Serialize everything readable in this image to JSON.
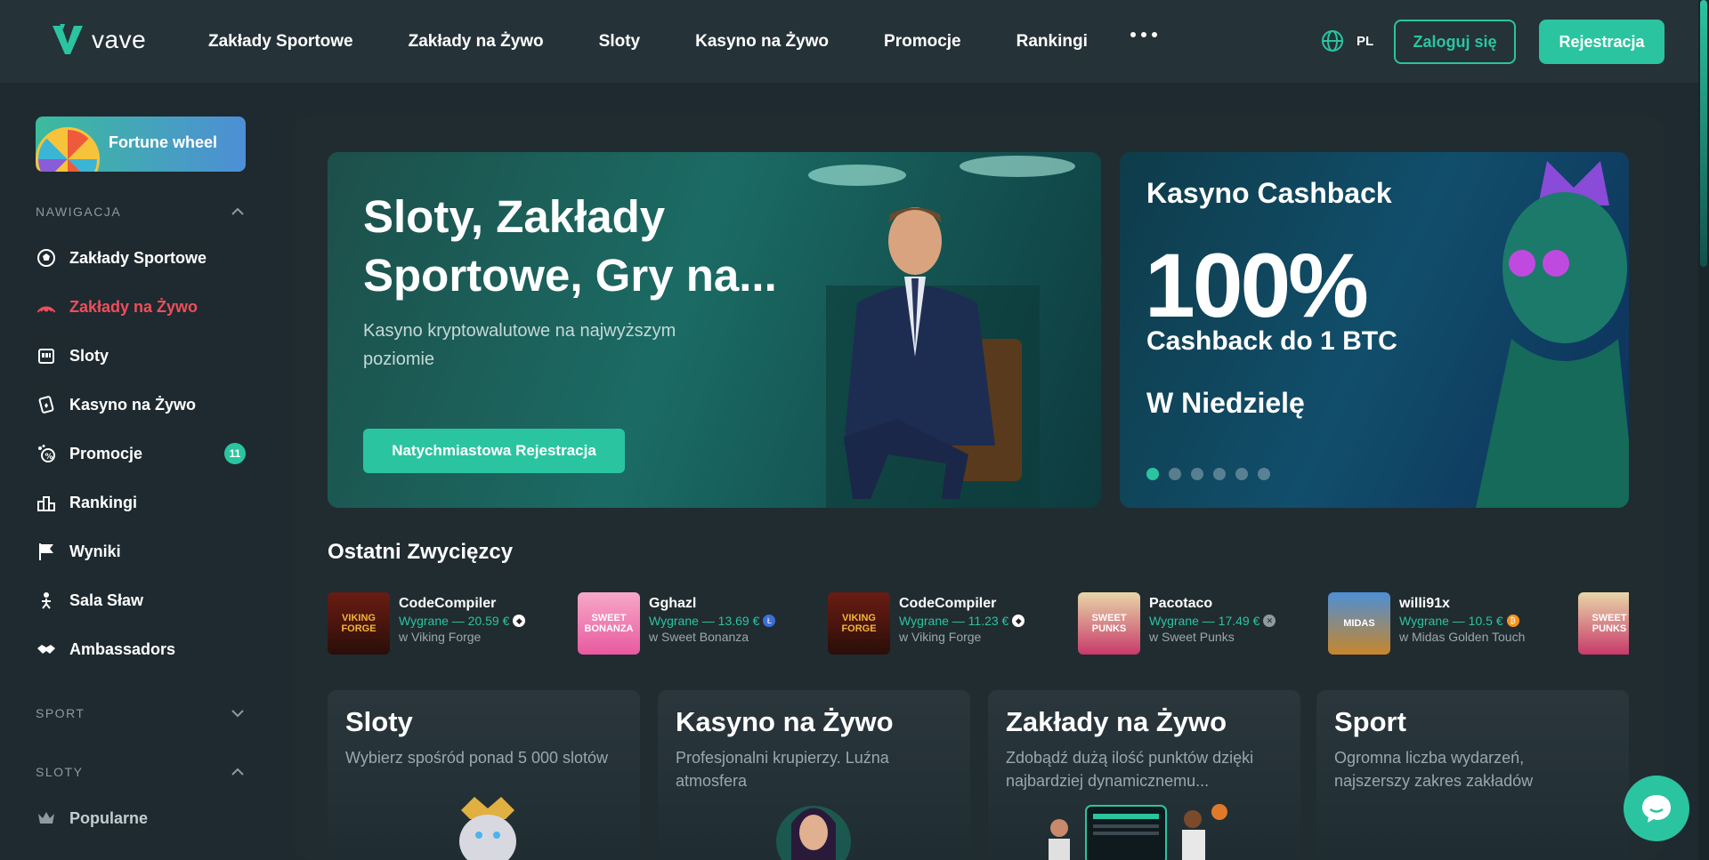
{
  "header": {
    "logo_text": "vave",
    "nav": [
      "Zakłady Sportowe",
      "Zakłady na Żywo",
      "Sloty",
      "Kasyno na Żywo",
      "Promocje",
      "Rankingi"
    ],
    "lang": "PL",
    "login_label": "Zaloguj się",
    "register_label": "Rejestracja"
  },
  "sidebar": {
    "fortune_label": "Fortune wheel",
    "nav_title": "NAWIGACJA",
    "items": [
      {
        "label": "Zakłady Sportowe",
        "icon": "soccer-ball-icon"
      },
      {
        "label": "Zakłady na Żywo",
        "icon": "live-signal-icon"
      },
      {
        "label": "Sloty",
        "icon": "slot-machine-icon"
      },
      {
        "label": "Kasyno na Żywo",
        "icon": "cards-icon"
      },
      {
        "label": "Promocje",
        "icon": "promo-icon",
        "badge": "11"
      },
      {
        "label": "Rankingi",
        "icon": "ranking-icon"
      },
      {
        "label": "Wyniki",
        "icon": "flag-icon"
      },
      {
        "label": "Sala Sław",
        "icon": "hall-of-fame-icon"
      },
      {
        "label": "Ambassadors",
        "icon": "handshake-icon"
      }
    ],
    "sport_title": "SPORT",
    "sloty_title": "SLOTY",
    "popular_label": "Popularne"
  },
  "hero": {
    "title": "Sloty, Zakłady Sportowe, Gry na...",
    "subtitle": "Kasyno kryptowalutowe na najwyższym poziomie",
    "button": "Natychmiastowa Rejestracja"
  },
  "promo": {
    "title": "Kasyno Cashback",
    "big": "100%",
    "line2": "Cashback do 1 BTC",
    "line3": "W Niedzielę",
    "active_dot": 0,
    "dot_count": 6
  },
  "winners": {
    "title": "Ostatni Zwycięzcy",
    "items": [
      {
        "name": "CodeCompiler",
        "amount": "Wygrane — 20.59 €",
        "game": "w Viking Forge",
        "thumb_text": "VIKING FORGE",
        "coin": "eth"
      },
      {
        "name": "Gghazl",
        "amount": "Wygrane — 13.69 €",
        "game": "w Sweet Bonanza",
        "thumb_text": "SWEET BONANZA",
        "coin": "ltc"
      },
      {
        "name": "CodeCompiler",
        "amount": "Wygrane — 11.23 €",
        "game": "w Viking Forge",
        "thumb_text": "VIKING FORGE",
        "coin": "eth"
      },
      {
        "name": "Pacotaco",
        "amount": "Wygrane — 17.49 €",
        "game": "w Sweet Punks",
        "thumb_text": "SWEET PUNKS",
        "coin": "xrp"
      },
      {
        "name": "willi91x",
        "amount": "Wygrane — 10.5 €",
        "game": "w Midas Golden Touch",
        "thumb_text": "MIDAS",
        "coin": "btc"
      },
      {
        "name": "",
        "amount": "",
        "game": "",
        "thumb_text": "SWEET PUNKS",
        "coin": ""
      }
    ]
  },
  "cards": [
    {
      "title": "Sloty",
      "desc": "Wybierz spośród ponad 5 000 slotów"
    },
    {
      "title": "Kasyno na Żywo",
      "desc": "Profesjonalni krupierzy. Luźna atmosfera"
    },
    {
      "title": "Zakłady na Żywo",
      "desc": "Zdobądź dużą ilość punktów dzięki najbardziej dynamicznemu..."
    },
    {
      "title": "Sport",
      "desc": "Ogromna liczba wydarzeń, najszerszy zakres zakładów"
    }
  ],
  "colors": {
    "accent": "#2bc4a0",
    "active": "#f04e5b",
    "bg": "#1e2a2f"
  }
}
